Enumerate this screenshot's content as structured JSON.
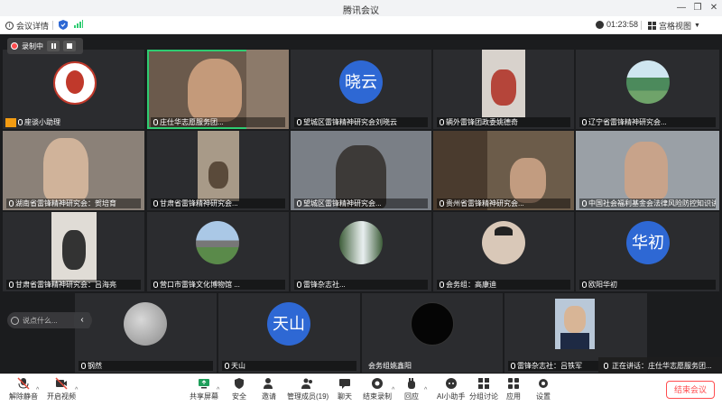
{
  "window": {
    "title": "腾讯会议"
  },
  "infobar": {
    "meeting_details": "会议详情",
    "duration": "01:23:58",
    "view_mode": "宫格视图"
  },
  "recording": {
    "label": "录制中"
  },
  "participants": [
    {
      "name": "座谈小助理"
    },
    {
      "name": "庄仕华志愿服务团..."
    },
    {
      "name": "望城区雷锋精神研究会刘晓云",
      "initials": "晓云"
    },
    {
      "name": "辆外雷锋团政委姚德奇"
    },
    {
      "name": "辽宁省雷锋精神研究会..."
    },
    {
      "name": "湖南省雷锋精神研究会：贺培育"
    },
    {
      "name": "甘肃省雷锋精神研究会..."
    },
    {
      "name": "望城区雷锋精神研究会..."
    },
    {
      "name": "贵州省雷锋精神研究会..."
    },
    {
      "name": "中国社会福利基金会法律风险防控知识讲"
    },
    {
      "name": "甘肃省雷锋精神研究会：吕海亮"
    },
    {
      "name": "营口市雷锋文化博物馆 ..."
    },
    {
      "name": "雷锋杂志社..."
    },
    {
      "name": "会务组：高康迪"
    },
    {
      "name": "欧阳华初",
      "initials": "华初"
    },
    {
      "name": "钢然"
    },
    {
      "name": "天山",
      "initials": "天山"
    },
    {
      "name": "会务组姚鑫阳"
    },
    {
      "name": "雷锋杂志社：吕铁军"
    }
  ],
  "chat": {
    "placeholder": "说点什么..."
  },
  "speaking": {
    "label": "正在讲话：庄仕华志愿服务团..."
  },
  "toolbar": {
    "unmute": "解除静音",
    "start_video": "开启视频",
    "share_screen": "共享屏幕",
    "security": "安全",
    "invite": "邀请",
    "manage_members": "管理成员(19)",
    "chat": "聊天",
    "end_recording": "结束录制",
    "reactions": "回应",
    "ai_assistant": "AI小助手",
    "breakout": "分组讨论",
    "apps": "应用",
    "settings": "设置",
    "end_meeting": "结束会议"
  },
  "colors": {
    "accent": "#2e68d4",
    "active_border": "#2ecc71",
    "danger": "#ff4d4f"
  }
}
